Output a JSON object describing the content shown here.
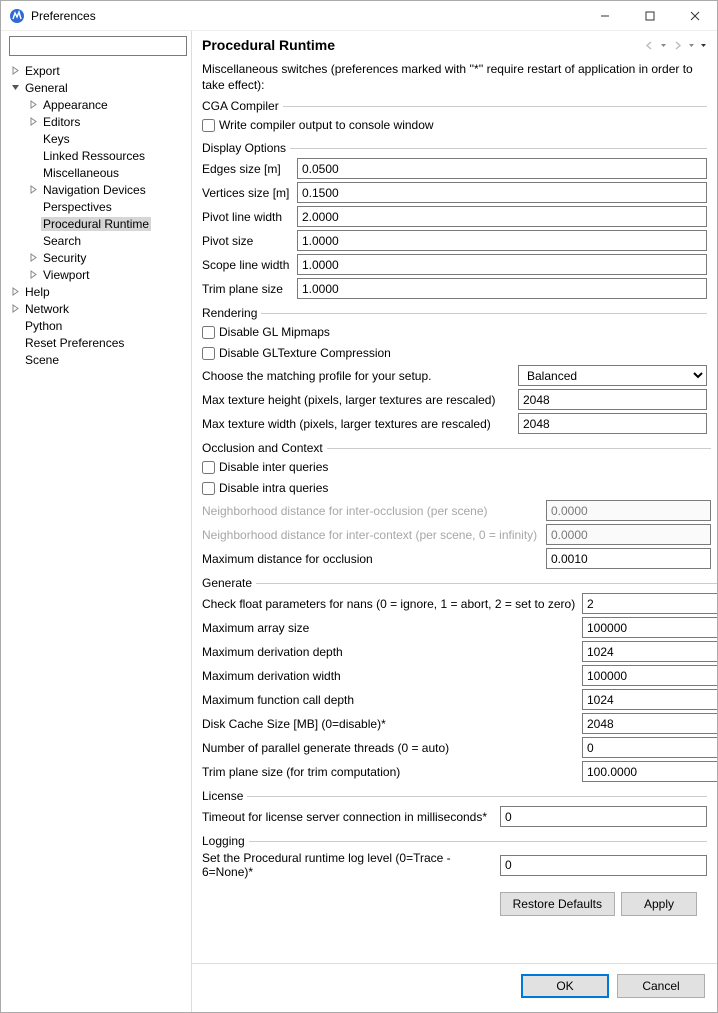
{
  "window": {
    "title": "Preferences"
  },
  "sidebar": {
    "filter_placeholder": "",
    "items": {
      "export": "Export",
      "general": "General",
      "appearance": "Appearance",
      "editors": "Editors",
      "keys": "Keys",
      "linked_resources": "Linked Ressources",
      "miscellaneous": "Miscellaneous",
      "navigation_devices": "Navigation Devices",
      "perspectives": "Perspectives",
      "procedural_runtime": "Procedural Runtime",
      "search": "Search",
      "security": "Security",
      "viewport": "Viewport",
      "help": "Help",
      "network": "Network",
      "python": "Python",
      "reset_preferences": "Reset Preferences",
      "scene": "Scene"
    }
  },
  "page": {
    "title": "Procedural Runtime",
    "intro": "Miscellaneous switches  (preferences marked with ''*'' require restart of application in order to take effect):",
    "groups": {
      "cga": {
        "legend": "CGA Compiler",
        "write_output": "Write compiler output to console window"
      },
      "display": {
        "legend": "Display Options",
        "edges_size": {
          "label": "Edges size [m]",
          "value": "0.0500"
        },
        "vertices_size": {
          "label": "Vertices size [m]",
          "value": "0.1500"
        },
        "pivot_line_width": {
          "label": "Pivot line width",
          "value": "2.0000"
        },
        "pivot_size": {
          "label": "Pivot size",
          "value": "1.0000"
        },
        "scope_line_width": {
          "label": "Scope line width",
          "value": "1.0000"
        },
        "trim_plane_size": {
          "label": "Trim plane size",
          "value": "1.0000"
        }
      },
      "rendering": {
        "legend": "Rendering",
        "disable_mipmaps": "Disable GL Mipmaps",
        "disable_compression": "Disable GLTexture Compression",
        "profile": {
          "label": "Choose the matching profile for your setup.",
          "value": "Balanced"
        },
        "max_tex_h": {
          "label": "Max texture height (pixels, larger textures are rescaled)",
          "value": "2048"
        },
        "max_tex_w": {
          "label": "Max texture width (pixels, larger textures are rescaled)",
          "value": "2048"
        }
      },
      "occlusion": {
        "legend": "Occlusion and Context",
        "disable_inter": "Disable inter queries",
        "disable_intra": "Disable intra queries",
        "nb_inter": {
          "label": "Neighborhood distance for inter-occlusion (per scene)",
          "value": "0.0000"
        },
        "nb_context": {
          "label": "Neighborhood distance for inter-context (per scene, 0 = infinity)",
          "value": "0.0000"
        },
        "max_dist": {
          "label": "Maximum distance for occlusion",
          "value": "0.0010"
        }
      },
      "generate": {
        "legend": "Generate",
        "check_nans": {
          "label": "Check float parameters for nans (0 = ignore, 1 = abort, 2 = set to zero)",
          "value": "2"
        },
        "max_array": {
          "label": "Maximum array size",
          "value": "100000"
        },
        "max_depth": {
          "label": "Maximum derivation depth",
          "value": "1024"
        },
        "max_width": {
          "label": "Maximum derivation width",
          "value": "100000"
        },
        "max_fn": {
          "label": "Maximum function call depth",
          "value": "1024"
        },
        "disk_cache": {
          "label": "Disk Cache Size [MB] (0=disable)*",
          "value": "2048"
        },
        "threads": {
          "label": "Number of parallel generate threads  (0 = auto)",
          "value": "0"
        },
        "trim": {
          "label": "Trim plane size (for trim computation)",
          "value": "100.0000"
        }
      },
      "license": {
        "legend": "License",
        "timeout": {
          "label": "Timeout for license server connection in milliseconds*",
          "value": "0"
        }
      },
      "logging": {
        "legend": "Logging",
        "level": {
          "label": "Set the Procedural runtime log level (0=Trace - 6=None)*",
          "value": "0"
        }
      }
    },
    "buttons": {
      "restore": "Restore Defaults",
      "apply": "Apply",
      "ok": "OK",
      "cancel": "Cancel"
    }
  }
}
